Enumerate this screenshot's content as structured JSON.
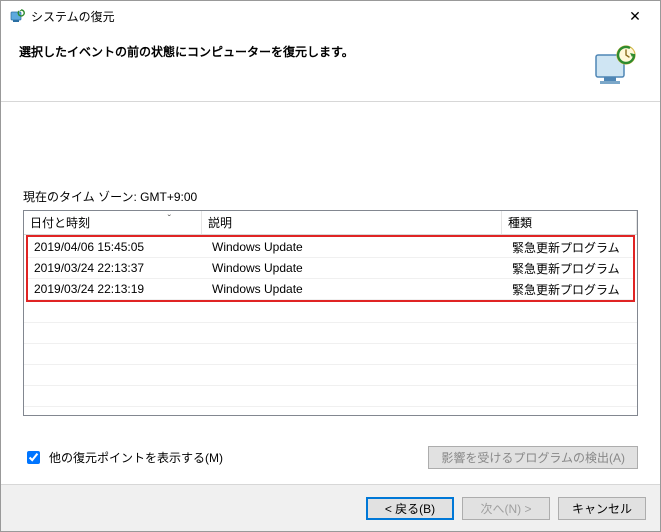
{
  "window": {
    "title": "システムの復元",
    "headline": "選択したイベントの前の状態にコンピューターを復元します。"
  },
  "timezone": {
    "label": "現在のタイム ゾーン: GMT+9:00"
  },
  "columns": {
    "date": "日付と時刻",
    "desc": "説明",
    "type": "種類"
  },
  "rows": [
    {
      "date": "2019/04/06 15:45:05",
      "desc": "Windows Update",
      "type": "緊急更新プログラム"
    },
    {
      "date": "2019/03/24 22:13:37",
      "desc": "Windows Update",
      "type": "緊急更新プログラム"
    },
    {
      "date": "2019/03/24 22:13:19",
      "desc": "Windows Update",
      "type": "緊急更新プログラム"
    }
  ],
  "checkbox": {
    "label": "他の復元ポイントを表示する(M)",
    "checked": true
  },
  "scan_button": "影響を受けるプログラムの検出(A)",
  "buttons": {
    "back": "< 戻る(B)",
    "next": "次へ(N) >",
    "cancel": "キャンセル"
  },
  "icons": {
    "close_glyph": "✕",
    "sort_glyph": "ˇ"
  }
}
